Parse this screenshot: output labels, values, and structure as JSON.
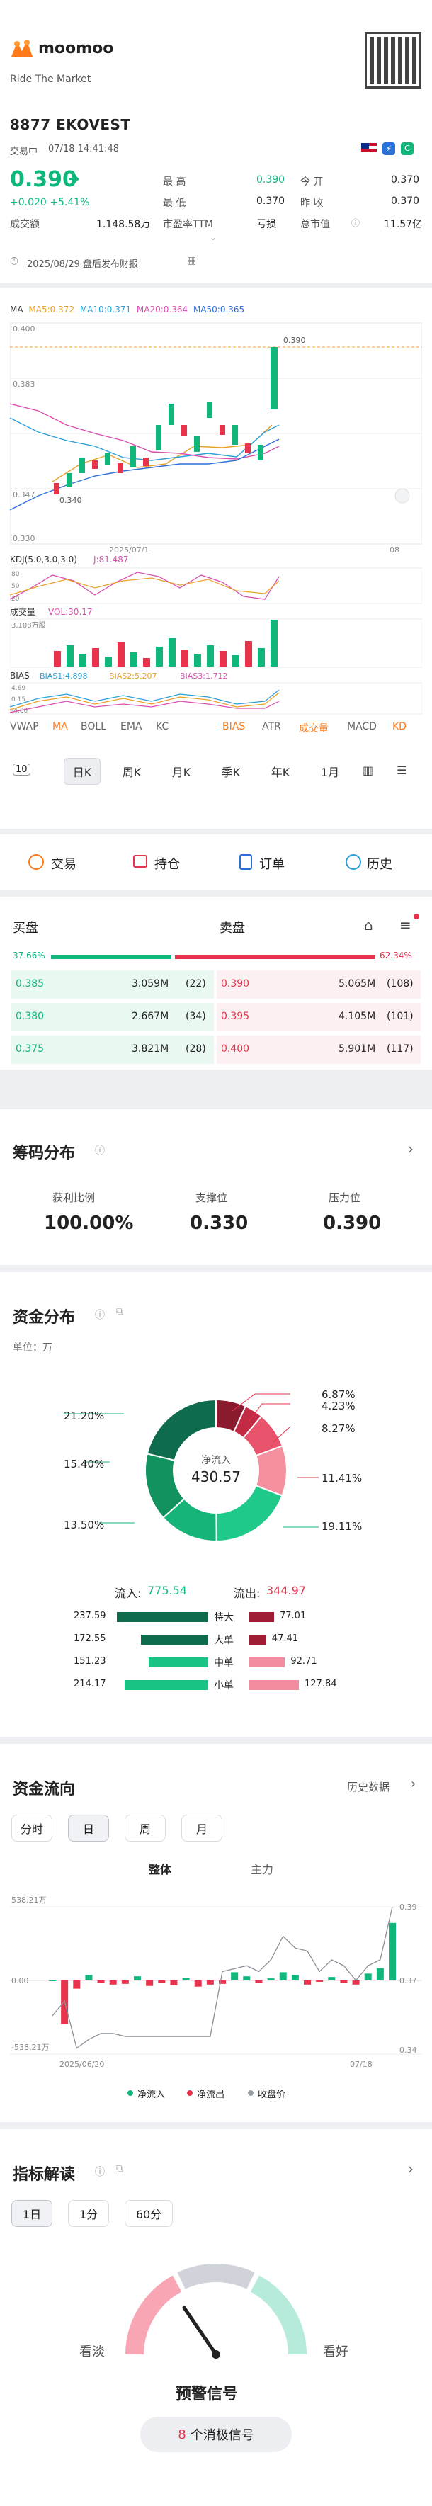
{
  "header": {
    "brand": "moomoo",
    "slogan": "Ride The Market"
  },
  "quote": {
    "code_name": "8877 EKOVEST",
    "status": "交易中",
    "datetime": "07/18 14:41:48",
    "price": "0.390",
    "change": "+0.020 +5.41%",
    "fields": [
      {
        "label": "最 高",
        "value": "0.390"
      },
      {
        "label": "今 开",
        "value": "0.370"
      },
      {
        "label": "最 低",
        "value": "0.370"
      },
      {
        "label": "昨 收",
        "value": "0.370"
      }
    ],
    "turnover_label": "成交额",
    "turnover": "1.148.58万",
    "pe_label": "市盈率TTM",
    "pe": "亏损",
    "mcap_label": "总市值",
    "mcap": "11.57亿",
    "report": "2025/08/29 盘后发布财报"
  },
  "chart": {
    "ma_legend": [
      {
        "t": "MA",
        "c": "#333"
      },
      {
        "t": "MA5:0.372",
        "c": "#e8a12a"
      },
      {
        "t": "MA10:0.371",
        "c": "#2b9fd8"
      },
      {
        "t": "MA20:0.364",
        "c": "#d94fb0"
      },
      {
        "t": "MA50:0.365",
        "c": "#2b6fd8"
      }
    ],
    "y_labels": [
      "0.400",
      "0.383",
      "0.347",
      "0.330"
    ],
    "callout_high": "0.390",
    "callout_low": "0.340",
    "date_mid": "2025/07/1",
    "date_right": "08",
    "kdj_label": "KDJ(5.0,3.0,3.0)",
    "kdj_val": "J:81.487",
    "kdj_y": [
      "80",
      "50",
      "20"
    ],
    "vol_label": "成交量",
    "vol_val": "VOL:30.17",
    "vol_y": "3,108万股",
    "bias_label": "BIAS",
    "bias_vals": [
      {
        "t": "BIAS1:4.898",
        "c": "#2b9fd8"
      },
      {
        "t": "BIAS2:5.207",
        "c": "#e8a12a"
      },
      {
        "t": "BIAS3:1.712",
        "c": "#d94fb0"
      }
    ],
    "bias_y": [
      "4.69",
      "0.15",
      "-4.80"
    ],
    "indicators": [
      "VWAP",
      "MA",
      "BOLL",
      "EMA",
      "KC",
      "BIAS",
      "ATR",
      "成交量",
      "MACD",
      "KD"
    ],
    "periods": [
      "10",
      "日K",
      "周K",
      "月K",
      "季K",
      "年K",
      "1月"
    ]
  },
  "actions": [
    {
      "label": "交易",
      "icon": "trade-icon"
    },
    {
      "label": "持仓",
      "icon": "position-icon"
    },
    {
      "label": "订单",
      "icon": "order-icon"
    },
    {
      "label": "历史",
      "icon": "history-icon"
    }
  ],
  "orderbook": {
    "bid_title": "买盘",
    "ask_title": "卖盘",
    "bid_pct": "37.66%",
    "ask_pct": "62.34%",
    "bid_ratio": 0.3766,
    "rows": [
      {
        "bp": "0.385",
        "bv": "3.059M",
        "bc": "(22)",
        "ap": "0.390",
        "av": "5.065M",
        "ac": "(108)"
      },
      {
        "bp": "0.380",
        "bv": "2.667M",
        "bc": "(34)",
        "ap": "0.395",
        "av": "4.105M",
        "ac": "(101)"
      },
      {
        "bp": "0.375",
        "bv": "3.821M",
        "bc": "(28)",
        "ap": "0.400",
        "av": "5.901M",
        "ac": "(117)"
      }
    ]
  },
  "chips": {
    "title": "筹码分布",
    "items": [
      {
        "label": "获利比例",
        "value": "100.00%"
      },
      {
        "label": "支撑位",
        "value": "0.330"
      },
      {
        "label": "压力位",
        "value": "0.390"
      }
    ]
  },
  "capital": {
    "title": "资金分布",
    "unit": "单位：万",
    "center_label": "净流入",
    "center_value": "430.57",
    "pct_left": [
      "21.20%",
      "15.40%",
      "13.50%"
    ],
    "pct_right": [
      "6.87%",
      "4.23%",
      "8.27%",
      "11.41%",
      "19.11%"
    ],
    "inflow_label": "流入:",
    "inflow": "775.54",
    "outflow_label": "流出:",
    "outflow": "344.97",
    "rows": [
      {
        "in": "237.59",
        "label": "特大",
        "out": "77.01",
        "inr": 0.92,
        "outr": 0.25
      },
      {
        "in": "172.55",
        "label": "大单",
        "out": "47.41",
        "inr": 0.68,
        "outr": 0.17
      },
      {
        "in": "151.23",
        "label": "中单",
        "out": "92.71",
        "inr": 0.6,
        "outr": 0.36
      },
      {
        "in": "214.17",
        "label": "小单",
        "out": "127.84",
        "inr": 0.84,
        "outr": 0.5
      }
    ]
  },
  "flow": {
    "title": "资金流向",
    "history": "历史数据",
    "periods": [
      "分时",
      "日",
      "周",
      "月"
    ],
    "tabs": [
      "整体",
      "主力"
    ],
    "y_left": [
      "538.21万",
      "0.00",
      "-538.21万"
    ],
    "y_right": [
      "0.39",
      "0.37",
      "0.34"
    ],
    "date_left": "2025/06/20",
    "date_right": "07/18",
    "legend": [
      {
        "t": "净流入",
        "c": "#10b67a"
      },
      {
        "t": "净流出",
        "c": "#e8334c"
      },
      {
        "t": "收盘价",
        "c": "#9aa0a8"
      }
    ],
    "bars": [
      0,
      -320,
      -60,
      40,
      -20,
      -30,
      -25,
      30,
      -40,
      -20,
      -35,
      20,
      -45,
      -30,
      -25,
      60,
      30,
      -20,
      15,
      60,
      40,
      -30,
      -10,
      25,
      -20,
      -30,
      50,
      90,
      420
    ],
    "price": [
      0.353,
      0.358,
      0.342,
      0.345,
      0.347,
      0.347,
      0.346,
      0.346,
      0.346,
      0.346,
      0.346,
      0.346,
      0.346,
      0.346,
      0.368,
      0.369,
      0.37,
      0.368,
      0.372,
      0.38,
      0.376,
      0.375,
      0.368,
      0.372,
      0.37,
      0.365,
      0.37,
      0.372,
      0.39
    ]
  },
  "indicator": {
    "title": "指标解读",
    "periods": [
      "1日",
      "1分",
      "60分"
    ],
    "bear": "看淡",
    "bull": "看好",
    "signal": "预警信号",
    "count_prefix": "8",
    "count_suffix": "个消极信号"
  }
}
